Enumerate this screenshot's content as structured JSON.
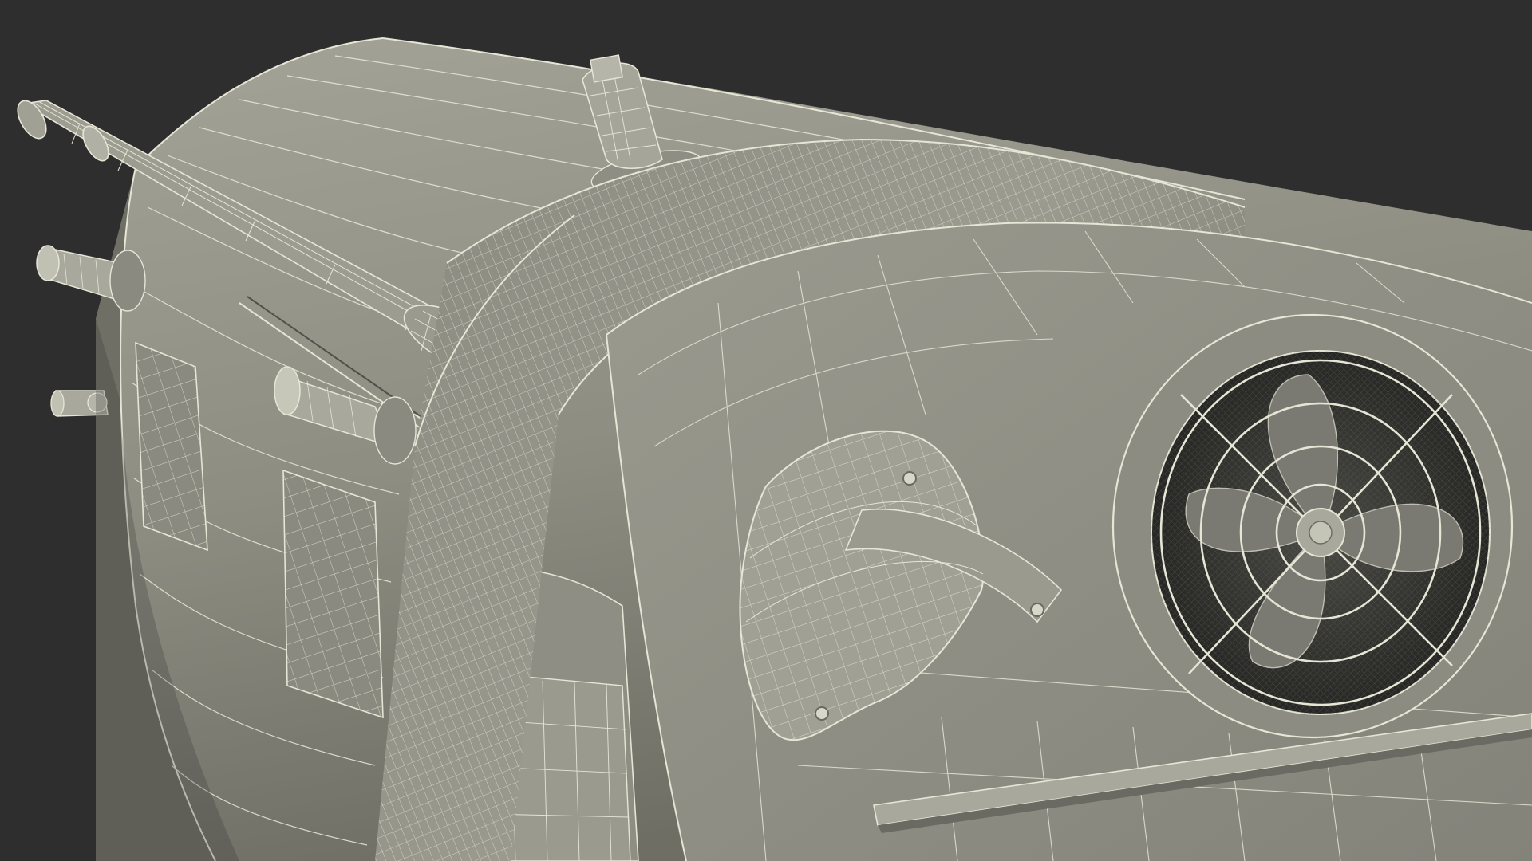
{
  "scene": {
    "subject": "satellite-wireframe-render",
    "colors": {
      "background": "#2e2e2e",
      "surface": "#8f8f84",
      "surface_light": "#a3a397",
      "surface_dark": "#6b6b62",
      "shadow": "#3c3c38",
      "wire": "#e6e6d6"
    }
  }
}
